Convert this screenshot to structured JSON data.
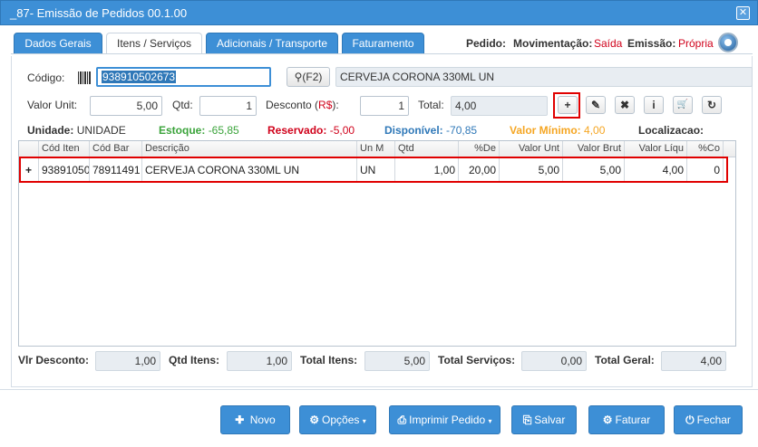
{
  "window": {
    "title": "_87- Emissão de Pedidos 00.1.00",
    "close_icon": "close-icon"
  },
  "tabs": [
    {
      "label": "Dados Gerais"
    },
    {
      "label": "Itens / Serviços"
    },
    {
      "label": "Adicionais / Transporte"
    },
    {
      "label": "Faturamento"
    }
  ],
  "header": {
    "pedido_label": "Pedido:",
    "movimentacao_label": "Movimentação:",
    "movimentacao_value": "Saída",
    "emissao_label": "Emissão:",
    "emissao_value": "Própria"
  },
  "form": {
    "codigo_label": "Código:",
    "codigo_value": "938910502673",
    "search_button": "(F2)",
    "descricao_value": "CERVEJA CORONA 330ML UN",
    "valor_unit_label": "Valor Unit:",
    "valor_unit_value": "5,00",
    "qtd_label": "Qtd:",
    "qtd_value": "1",
    "desconto_label": "Desconto (",
    "desconto_currency": "R$",
    "desconto_suffix": "):",
    "desconto_value": "1",
    "total_label": "Total:",
    "total_value": "4,00"
  },
  "item_buttons": [
    {
      "icon": "plus-icon",
      "glyph": "+"
    },
    {
      "icon": "edit-icon",
      "glyph": "✎"
    },
    {
      "icon": "delete-icon",
      "glyph": "✖"
    },
    {
      "icon": "info-icon",
      "glyph": "i"
    },
    {
      "icon": "cart-icon",
      "glyph": "🛒"
    },
    {
      "icon": "refresh-icon",
      "glyph": "↻"
    }
  ],
  "stock_info": {
    "unidade_label": "Unidade:",
    "unidade_value": "UNIDADE",
    "estoque_label": "Estoque:",
    "estoque_value": "-65,85",
    "reservado_label": "Reservado:",
    "reservado_value": "-5,00",
    "disponivel_label": "Disponível:",
    "disponivel_value": "-70,85",
    "valor_minimo_label": "Valor Mínimo:",
    "valor_minimo_value": "4,00",
    "localizacao_label": "Localizacao:"
  },
  "colors": {
    "accent": "#3d8fd6",
    "estoque": "#3aa33a",
    "reservado": "#d0021b",
    "disponivel": "#2f78b8",
    "valor_minimo": "#f5a623"
  },
  "grid": {
    "columns": [
      "Cód Iten",
      "Cód Bar",
      "Descrição",
      "Un M",
      "Qtd",
      "%De",
      "Valor Unt",
      "Valor Brut",
      "Valor Líqu",
      "%Co"
    ],
    "rows": [
      {
        "expand": "+",
        "cells": [
          "93891050",
          "78911491",
          "CERVEJA CORONA 330ML UN",
          "UN",
          "1,00",
          "20,00",
          "5,00",
          "5,00",
          "4,00",
          "0"
        ]
      }
    ]
  },
  "totals": {
    "vlr_desconto_label": "Vlr Desconto:",
    "vlr_desconto_value": "1,00",
    "qtd_itens_label": "Qtd Itens:",
    "qtd_itens_value": "1,00",
    "total_itens_label": "Total Itens:",
    "total_itens_value": "5,00",
    "total_servicos_label": "Total Serviços:",
    "total_servicos_value": "0,00",
    "total_geral_label": "Total Geral:",
    "total_geral_value": "4,00"
  },
  "actions": {
    "novo": "Novo",
    "opcoes": "Opções",
    "imprimir": "Imprimir Pedido",
    "salvar": "Salvar",
    "faturar": "Faturar",
    "fechar": "Fechar"
  }
}
